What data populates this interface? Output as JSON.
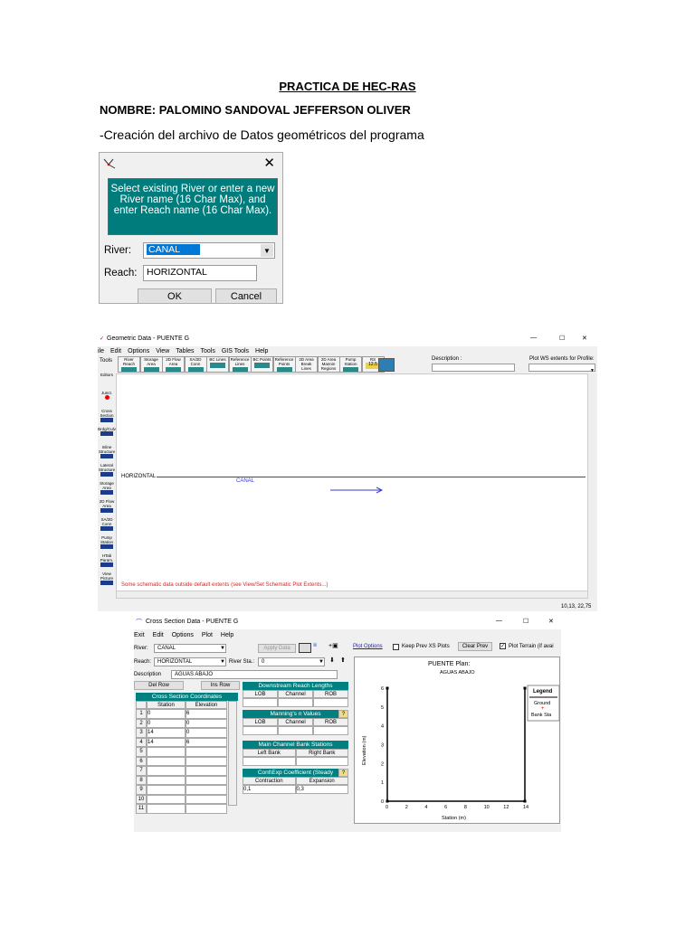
{
  "document": {
    "title": "PRACTICA DE HEC-RAS",
    "name_line": "NOMBRE: PALOMINO SANDOVAL JEFFERSON OLIVER",
    "subtitle": "-Creación del archivo de Datos geométricos del programa"
  },
  "river_dialog": {
    "message": "Select existing River or enter a new River name (16 Char Max), and enter Reach name (16 Char Max).",
    "river_label": "River:",
    "river_value": "CANAL",
    "reach_label": "Reach:",
    "reach_value": "HORIZONTAL",
    "ok": "OK",
    "cancel": "Cancel",
    "close": "✕"
  },
  "geometric_window": {
    "title": "Geometric Data - PUENTE G",
    "menu": [
      "ile",
      "Edit",
      "Options",
      "View",
      "Tables",
      "Tools",
      "GIS Tools",
      "Help"
    ],
    "toolbar": [
      "River Reach",
      "Storage Area",
      "2D Flow Area",
      "SA/2D Conn",
      "BC Lines",
      "Reference Lines",
      "BC Points",
      "Reference Points",
      "2D Area Break Lines",
      "2D Area Mannin Regions",
      "Pump Station",
      "RS"
    ],
    "rs_badge": "12.5",
    "tools_label": "Tools",
    "description_label": "Description :",
    "plot_ws_label": "Plot WS extents for Profile:",
    "left_tools": [
      "Editors",
      "Junct.",
      "Cross Section",
      "Brdg/Culv",
      "Inline Structure",
      "Lateral Structure",
      "Storage Area",
      "2D Flow Area",
      "SA/2D Conn",
      "Pump Station",
      "HTab Param.",
      "View Picture"
    ],
    "reach_label": "HORIZONTAL",
    "river_label": "CANAL",
    "warning": "Some schematic data outside default extents (see View/Set Schematic Plot Extents...)",
    "coords": "10,13, 22,75"
  },
  "xs_window": {
    "title": "Cross Section Data - PUENTE G",
    "menu": [
      "Exit",
      "Edit",
      "Options",
      "Plot",
      "Help"
    ],
    "river_label": "River:",
    "river": "CANAL",
    "reach_label": "Reach:",
    "reach": "HORIZONTAL",
    "river_sta_label": "River Sta.:",
    "river_sta": "0",
    "apply": "Apply Data",
    "description_label": "Description",
    "description": "AGUAS ABAJO",
    "del_row": "Del Row",
    "ins_row": "Ins Row",
    "coords_header": "Cross Section Coordinates",
    "col_station": "Station",
    "col_elevation": "Elevation",
    "rows": [
      [
        "1",
        "0",
        "6"
      ],
      [
        "2",
        "0",
        "0"
      ],
      [
        "3",
        "14",
        "0"
      ],
      [
        "4",
        "14",
        "6"
      ],
      [
        "5",
        "",
        ""
      ],
      [
        "6",
        "",
        ""
      ],
      [
        "7",
        "",
        ""
      ],
      [
        "8",
        "",
        ""
      ],
      [
        "9",
        "",
        ""
      ],
      [
        "10",
        "",
        ""
      ],
      [
        "11",
        "",
        ""
      ]
    ],
    "downstream": {
      "header": "Downstream Reach Lengths",
      "cols": [
        "LOB",
        "Channel",
        "ROB"
      ]
    },
    "manning": {
      "header": "Manning's n Values",
      "cols": [
        "LOB",
        "Channel",
        "ROB"
      ]
    },
    "bank": {
      "header": "Main Channel Bank Stations",
      "cols": [
        "Left Bank",
        "Right Bank"
      ]
    },
    "coef": {
      "header": "Cont\\Exp Coefficient (Steady",
      "cols": [
        "Contraction",
        "Expansion"
      ],
      "values": [
        "0,1",
        "0,3"
      ]
    },
    "plot_options": "Plot Options",
    "keep_prev": "Keep Prev XS Plots",
    "clear_prev": "Clear Prev",
    "plot_terrain": "Plot Terrain (if avai"
  },
  "chart_data": {
    "type": "line",
    "title": "PUENTE        Plan:",
    "subtitle": "AGUAS ABAJO",
    "xlabel": "Station (m)",
    "ylabel": "Elevation (m)",
    "xlim": [
      0,
      14
    ],
    "ylim": [
      0,
      6
    ],
    "xticks": [
      "0",
      "2",
      "4",
      "6",
      "8",
      "10",
      "12",
      "14"
    ],
    "yticks": [
      "0",
      "1",
      "2",
      "3",
      "4",
      "5",
      "6"
    ],
    "series": [
      {
        "name": "Ground",
        "x": [
          0,
          0,
          14,
          14
        ],
        "y": [
          6,
          0,
          0,
          6
        ],
        "color": "#000000"
      }
    ],
    "legend": {
      "title": "Legend",
      "entries": [
        "Ground",
        "Bank Sta"
      ],
      "placement": "right"
    }
  }
}
